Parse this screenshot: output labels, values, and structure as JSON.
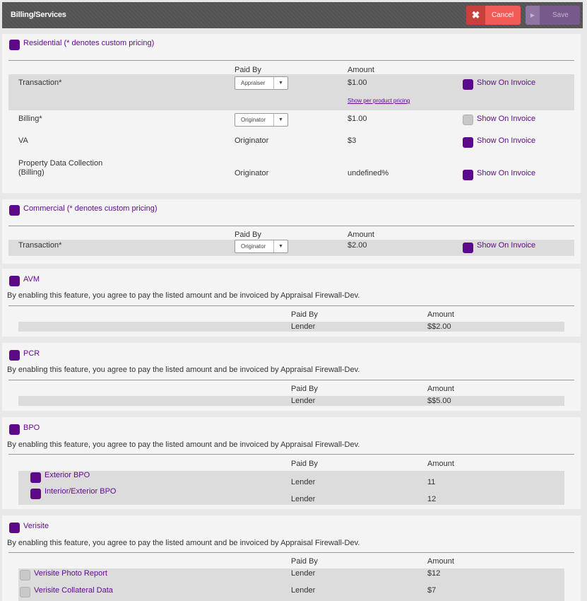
{
  "header": {
    "title": "Billing/Services",
    "cancel_label": "Cancel",
    "save_label": "Save"
  },
  "residential": {
    "title": "Residential (* denotes custom pricing)",
    "col_paid_by": "Paid By",
    "col_amount": "Amount",
    "rows": [
      {
        "name": "Transaction*",
        "paid_by": "Appraiser",
        "amount": "$1.00",
        "show_on_invoice": "Show On Invoice",
        "link": "Show per product pricing"
      },
      {
        "name": "Billing*",
        "paid_by": "Originator",
        "amount": "$1.00",
        "show_on_invoice": "Show On Invoice"
      },
      {
        "name": "VA",
        "paid_by": "Originator",
        "amount": "$3",
        "show_on_invoice": "Show On Invoice"
      },
      {
        "name": "Property Data Collection (Billing)",
        "name_line1": "Property Data Collection",
        "name_line2": "(Billing)",
        "paid_by": "Originator",
        "amount": "undefined%",
        "show_on_invoice": "Show On Invoice"
      }
    ]
  },
  "commercial": {
    "title": "Commercial (* denotes custom pricing)",
    "col_paid_by": "Paid By",
    "col_amount": "Amount",
    "rows": [
      {
        "name": "Transaction*",
        "paid_by": "Originator",
        "amount": "$2.00",
        "show_on_invoice": "Show On Invoice"
      }
    ]
  },
  "avm": {
    "title": "AVM",
    "agreement": "By enabling this feature, you agree to pay the listed amount and be invoiced by Appraisal Firewall-Dev.",
    "col_paid_by": "Paid By",
    "col_amount": "Amount",
    "paid_by": "Lender",
    "amount": "$$2.00"
  },
  "pcr": {
    "title": "PCR",
    "agreement": "By enabling this feature, you agree to pay the listed amount and be invoiced by Appraisal Firewall-Dev.",
    "col_paid_by": "Paid By",
    "col_amount": "Amount",
    "paid_by": "Lender",
    "amount": "$$5.00"
  },
  "bpo": {
    "title": "BPO",
    "agreement": "By enabling this feature, you agree to pay the listed amount and be invoiced by Appraisal Firewall-Dev.",
    "col_paid_by": "Paid By",
    "col_amount": "Amount",
    "items": [
      {
        "name": "Exterior BPO",
        "paid_by": "Lender",
        "amount": "11"
      },
      {
        "name": "Interior/Exterior BPO",
        "paid_by": "Lender",
        "amount": "12"
      }
    ]
  },
  "verisite": {
    "title": "Verisite",
    "agreement": "By enabling this feature, you agree to pay the listed amount and be invoiced by Appraisal Firewall-Dev.",
    "col_paid_by": "Paid By",
    "col_amount": "Amount",
    "items": [
      {
        "name": "Verisite Photo Report",
        "paid_by": "Lender",
        "amount": "$12"
      },
      {
        "name": "Verisite Collateral Data",
        "paid_by": "Lender",
        "amount": "$7"
      }
    ]
  },
  "colors": {
    "accent": "#5d0a8a",
    "cancel": "#f05c55",
    "save": "#7e5a96",
    "header": "#555555"
  }
}
